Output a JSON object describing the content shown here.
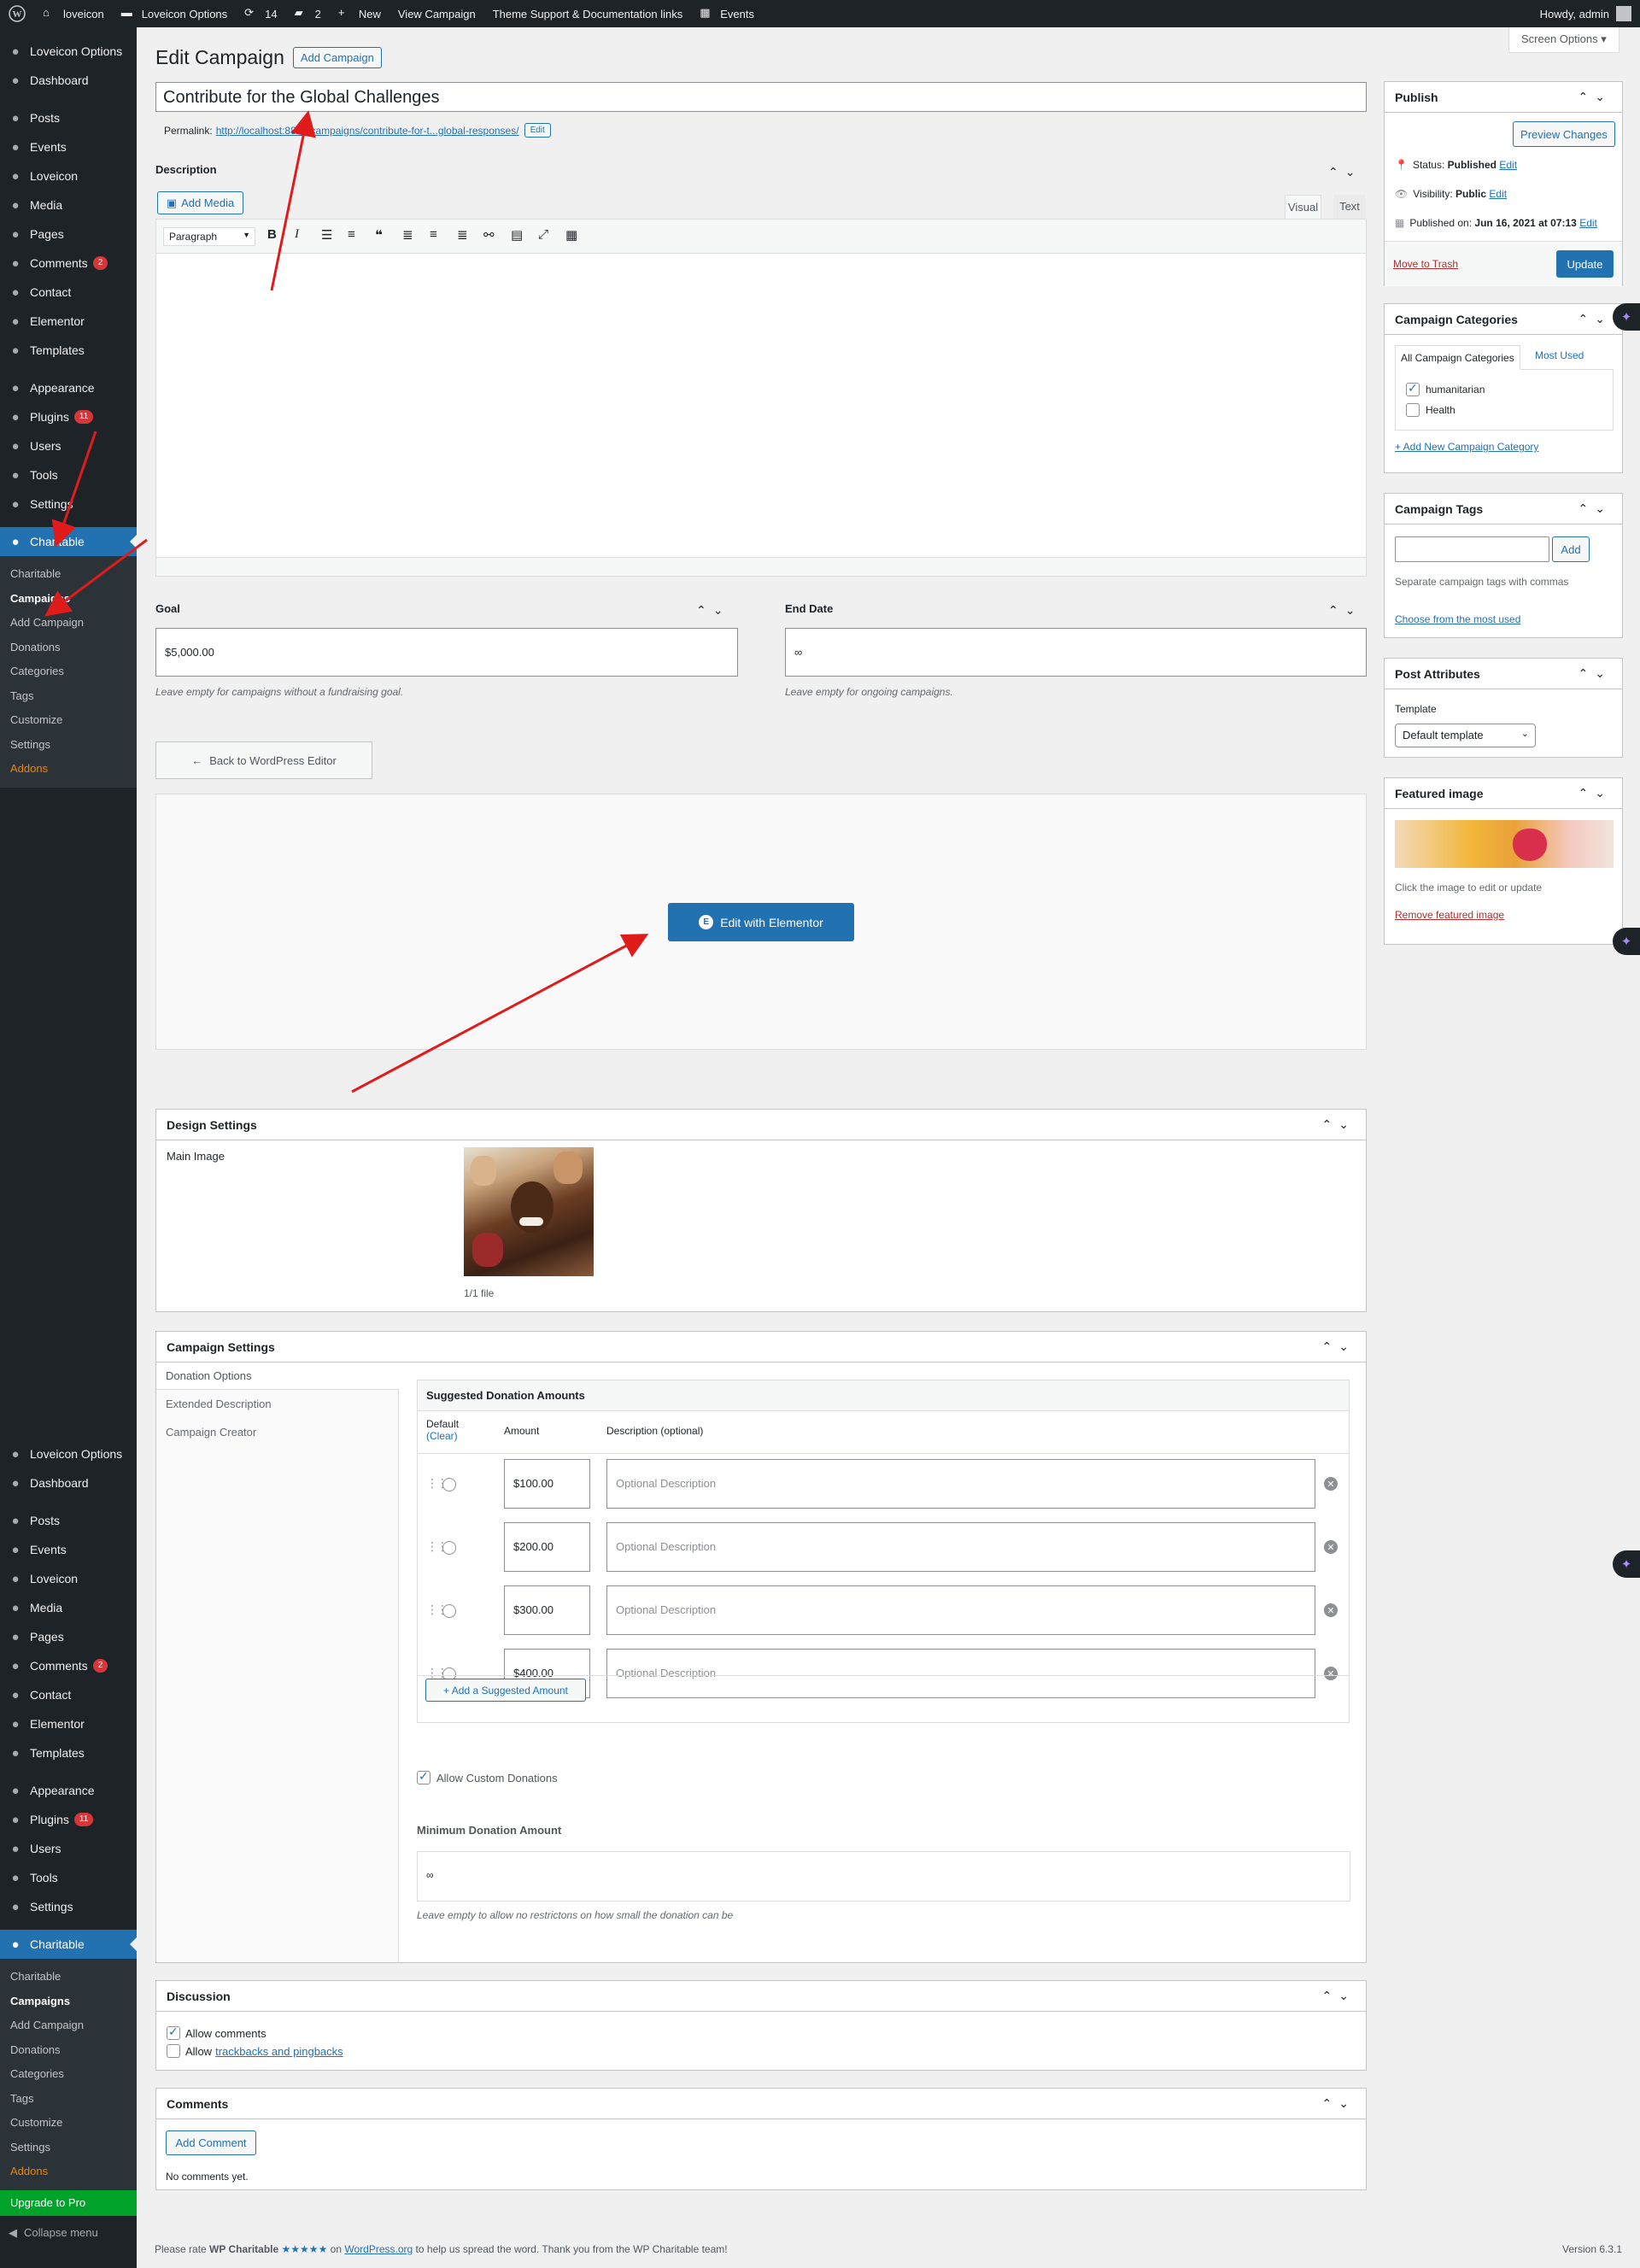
{
  "admin_bar": {
    "site_name": "loveicon",
    "options": "Loveicon Options",
    "updates": "14",
    "comments": "2",
    "new": "New",
    "view": "View Campaign",
    "theme_support": "Theme Support & Documentation links",
    "events": "Events",
    "howdy": "Howdy, admin"
  },
  "sidebar": {
    "top_items": [
      {
        "label": "Loveicon Options",
        "icon": "gear-icon"
      },
      {
        "label": "Dashboard",
        "icon": "dashboard-icon"
      },
      {
        "label": "Posts",
        "icon": "pin-icon"
      },
      {
        "label": "Events",
        "icon": "calendar-icon"
      },
      {
        "label": "Loveicon",
        "icon": "gear-icon"
      },
      {
        "label": "Media",
        "icon": "media-icon"
      },
      {
        "label": "Pages",
        "icon": "page-icon"
      },
      {
        "label": "Comments",
        "icon": "comment-icon",
        "badge": "2"
      },
      {
        "label": "Contact",
        "icon": "mail-icon"
      },
      {
        "label": "Elementor",
        "icon": "elementor-icon"
      },
      {
        "label": "Templates",
        "icon": "folder-icon"
      },
      {
        "label": "Appearance",
        "icon": "brush-icon"
      },
      {
        "label": "Plugins",
        "icon": "plugin-icon",
        "badge": "11"
      },
      {
        "label": "Users",
        "icon": "user-icon"
      },
      {
        "label": "Tools",
        "icon": "wrench-icon"
      },
      {
        "label": "Settings",
        "icon": "settings-icon"
      },
      {
        "label": "Charitable",
        "icon": "hand-icon"
      }
    ],
    "submenu": [
      "Charitable",
      "Campaigns",
      "Add Campaign",
      "Donations",
      "Categories",
      "Tags",
      "Customize",
      "Settings",
      "Addons"
    ],
    "upgrade": "Upgrade to Pro",
    "collapse": "Collapse menu"
  },
  "screen_options": "Screen Options ▾",
  "header": {
    "title": "Edit Campaign",
    "add_new": "Add Campaign"
  },
  "post": {
    "title": "Contribute for the Global Challenges",
    "permalink_label": "Permalink:",
    "permalink_url": "http://localhost:8813/campaigns/contribute-for-t...global-responses/",
    "permalink_edit": "Edit"
  },
  "description": {
    "label": "Description",
    "add_media": "Add Media",
    "tab_visual": "Visual",
    "tab_text": "Text",
    "format": "Paragraph"
  },
  "goal": {
    "label": "Goal",
    "value": "$5,000.00",
    "help": "Leave empty for campaigns without a fundraising goal."
  },
  "end_date": {
    "label": "End Date",
    "value": "∞",
    "help": "Leave empty for ongoing campaigns."
  },
  "back_editor": "Back to WordPress Editor",
  "elementor_btn": "Edit with Elementor",
  "design": {
    "title": "Design Settings",
    "main_image": "Main Image",
    "file_count": "1/1 file"
  },
  "campaign_settings": {
    "title": "Campaign Settings",
    "tabs": [
      "Donation Options",
      "Extended Description",
      "Campaign Creator"
    ],
    "suggested_title": "Suggested Donation Amounts",
    "col_default": "Default",
    "col_clear": "(Clear)",
    "col_amount": "Amount",
    "col_description": "Description (optional)",
    "rows": [
      {
        "amount": "$100.00",
        "placeholder": "Optional Description"
      },
      {
        "amount": "$200.00",
        "placeholder": "Optional Description"
      },
      {
        "amount": "$300.00",
        "placeholder": "Optional Description"
      },
      {
        "amount": "$400.00",
        "placeholder": "Optional Description"
      }
    ],
    "add_amount": "+ Add a Suggested Amount",
    "allow_custom": "Allow Custom Donations",
    "min_label": "Minimum Donation Amount",
    "min_value": "∞",
    "min_help": "Leave empty to allow no restrictons on how small the donation can be"
  },
  "discussion": {
    "title": "Discussion",
    "allow_comments": "Allow comments",
    "allow_prefix": "Allow",
    "trackbacks": "trackbacks and pingbacks"
  },
  "comments_box": {
    "title": "Comments",
    "add": "Add Comment",
    "none": "No comments yet."
  },
  "publish": {
    "title": "Publish",
    "preview": "Preview Changes",
    "status_label": "Status:",
    "status": "Published",
    "visibility_label": "Visibility:",
    "visibility": "Public",
    "published_label": "Published on:",
    "published": "Jun 16, 2021 at 07:13",
    "edit": "Edit",
    "trash": "Move to Trash",
    "update": "Update"
  },
  "categories": {
    "title": "Campaign Categories",
    "tab_all": "All Campaign Categories",
    "tab_most": "Most Used",
    "items": [
      {
        "label": "humanitarian",
        "checked": true
      },
      {
        "label": "Health",
        "checked": false
      }
    ],
    "add_new": "+ Add New Campaign Category"
  },
  "tags": {
    "title": "Campaign Tags",
    "add": "Add",
    "help": "Separate campaign tags with commas",
    "choose": "Choose from the most used"
  },
  "attributes": {
    "title": "Post Attributes",
    "template_label": "Template",
    "template": "Default template"
  },
  "featured": {
    "title": "Featured image",
    "help": "Click the image to edit or update",
    "remove": "Remove featured image"
  },
  "footer": {
    "rate_prefix": "Please rate",
    "plugin": "WP Charitable",
    "stars": "★★★★★",
    "on": "on",
    "wporg": "WordPress.org",
    "rate_suffix": "to help us spread the word. Thank you from the WP Charitable team!",
    "version": "Version 6.3.1"
  },
  "colors": {
    "accent": "#2271b1",
    "sidebar": "#1d2327",
    "arrow": "#e01b1b"
  }
}
